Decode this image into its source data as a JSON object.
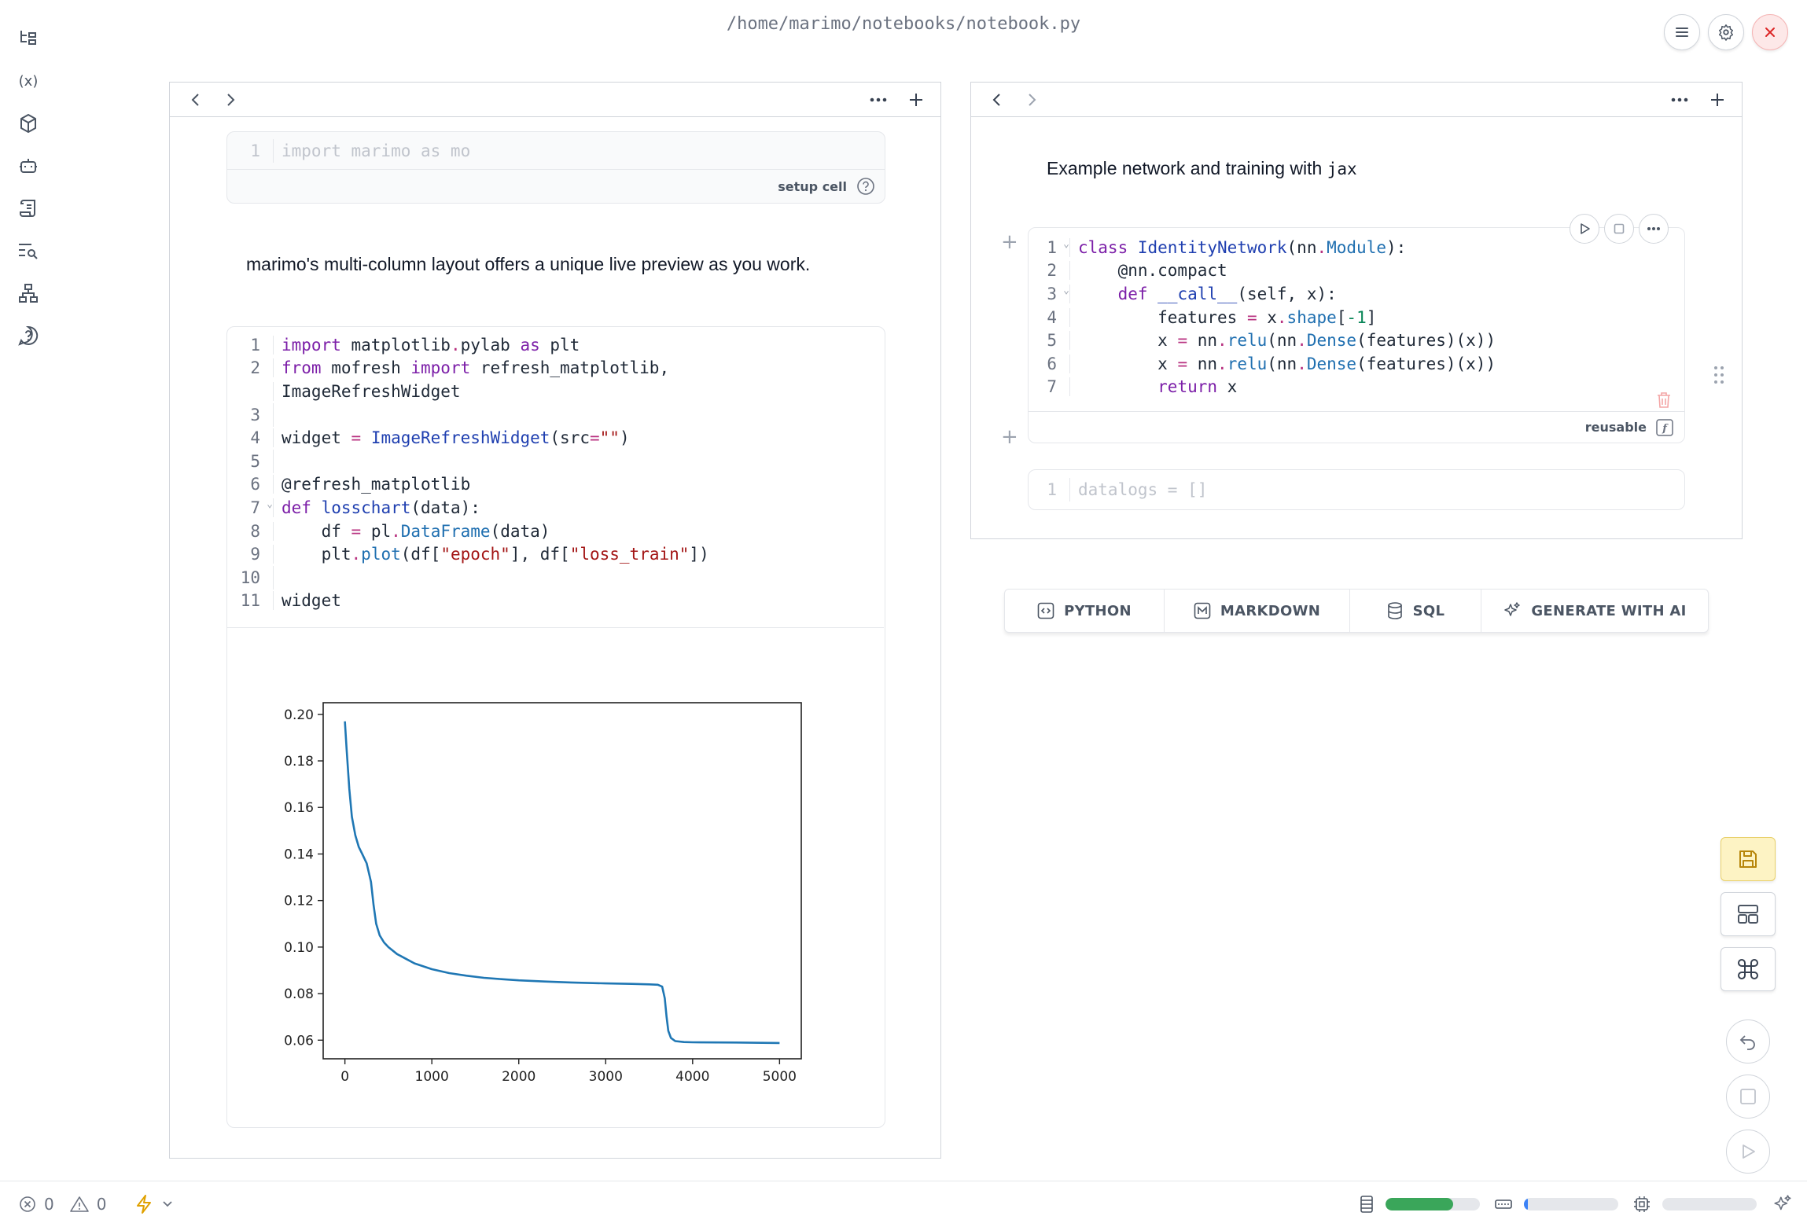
{
  "header": {
    "file_path": "/home/marimo/notebooks/notebook.py"
  },
  "sidebar": {
    "icons": [
      "file-tree-icon",
      "variables-icon",
      "package-icon",
      "ai-bot-icon",
      "scroll-icon",
      "search-list-icon",
      "dependency-graph-icon",
      "help-icon"
    ]
  },
  "column1": {
    "setup_cell": {
      "line_number": "1",
      "code": "import marimo as mo",
      "label": "setup cell"
    },
    "markdown": "marimo's multi-column layout offers a unique live preview as you work.",
    "code_cell": {
      "line_numbers": [
        "1",
        "2",
        "",
        "3",
        "4",
        "5",
        "6",
        "7",
        "8",
        "9",
        "10",
        "11"
      ],
      "lines": [
        "import matplotlib.pylab as plt",
        "from mofresh import refresh_matplotlib,",
        "ImageRefreshWidget",
        "",
        "widget = ImageRefreshWidget(src=\"\")",
        "",
        "@refresh_matplotlib",
        "def losschart(data):",
        "    df = pl.DataFrame(data)",
        "    plt.plot(df[\"epoch\"], df[\"loss_train\"])",
        "",
        "widget"
      ]
    }
  },
  "column2": {
    "markdown_prefix": "Example network and training with ",
    "markdown_code": "jax",
    "identity_cell": {
      "line_numbers": [
        "1",
        "2",
        "3",
        "4",
        "5",
        "6",
        "7"
      ],
      "lines": [
        "class IdentityNetwork(nn.Module):",
        "    @nn.compact",
        "    def __call__(self, x):",
        "        features = x.shape[-1]",
        "        x = nn.relu(nn.Dense(features)(x))",
        "        x = nn.relu(nn.Dense(features)(x))",
        "        return x"
      ],
      "label": "reusable"
    },
    "datalogs_cell": {
      "line_number": "1",
      "code": "datalogs = []"
    }
  },
  "add_cell_bar": {
    "python": "PYTHON",
    "markdown": "MARKDOWN",
    "sql": "SQL",
    "ai": "GENERATE WITH AI"
  },
  "footer": {
    "errors": "0",
    "warnings": "0",
    "memory_fraction": 0.72,
    "kernel_memory_fraction": 0.04,
    "cpu_fraction": 0.0
  },
  "chart_data": {
    "type": "line",
    "title": "",
    "xlabel": "",
    "ylabel": "",
    "xlim": [
      -250,
      5250
    ],
    "ylim": [
      0.052,
      0.205
    ],
    "x_ticks": [
      0,
      1000,
      2000,
      3000,
      4000,
      5000
    ],
    "y_ticks": [
      0.06,
      0.08,
      0.1,
      0.12,
      0.14,
      0.16,
      0.18,
      0.2
    ],
    "y_tick_labels": [
      "0.06",
      "0.08",
      "0.10",
      "0.12",
      "0.14",
      "0.16",
      "0.18",
      "0.20"
    ],
    "series": [
      {
        "color": "#1f77b4",
        "x": [
          0,
          20,
          50,
          80,
          120,
          160,
          200,
          250,
          300,
          330,
          360,
          400,
          450,
          500,
          600,
          700,
          800,
          1000,
          1200,
          1400,
          1600,
          1800,
          2000,
          2300,
          2600,
          3000,
          3300,
          3500,
          3600,
          3650,
          3680,
          3700,
          3720,
          3750,
          3800,
          3900,
          4000,
          4500,
          5000
        ],
        "y": [
          0.197,
          0.185,
          0.168,
          0.156,
          0.148,
          0.143,
          0.14,
          0.136,
          0.128,
          0.118,
          0.11,
          0.105,
          0.102,
          0.1,
          0.097,
          0.095,
          0.093,
          0.0905,
          0.0888,
          0.0877,
          0.0868,
          0.0862,
          0.0857,
          0.0852,
          0.0848,
          0.0844,
          0.0842,
          0.084,
          0.0838,
          0.083,
          0.078,
          0.07,
          0.064,
          0.061,
          0.0596,
          0.0592,
          0.0591,
          0.059,
          0.0588
        ]
      }
    ]
  }
}
